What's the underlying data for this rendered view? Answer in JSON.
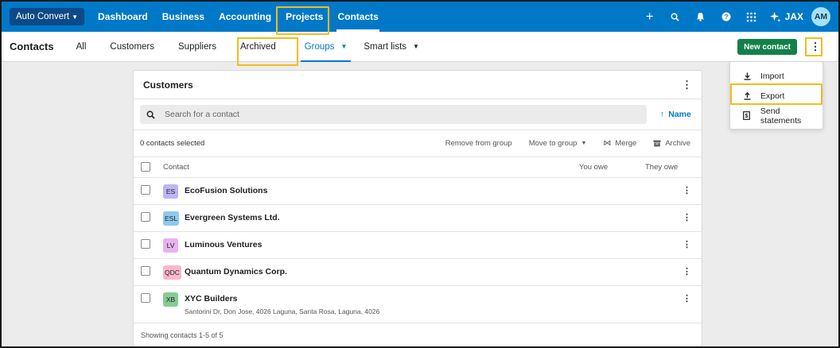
{
  "topnav": {
    "org_label": "Auto Convert",
    "links": [
      "Dashboard",
      "Business",
      "Accounting",
      "Projects",
      "Contacts"
    ],
    "jax_label": "JAX",
    "avatar_initials": "AM"
  },
  "subnav": {
    "title": "Contacts",
    "tabs": [
      "All",
      "Customers",
      "Suppliers",
      "Archived",
      "Groups",
      "Smart lists"
    ],
    "new_contact_label": "New contact"
  },
  "dropdown": {
    "items": [
      "Import",
      "Export",
      "Send statements"
    ]
  },
  "card": {
    "title": "Customers",
    "search_placeholder": "Search for a contact",
    "sort_label": "Name",
    "selected_text": "0 contacts selected",
    "actions": {
      "remove": "Remove from group",
      "move": "Move to group",
      "merge": "Merge",
      "archive": "Archive"
    },
    "columns": {
      "contact": "Contact",
      "you_owe": "You owe",
      "they_owe": "They owe"
    },
    "rows": [
      {
        "initials": "ES",
        "name": "EcoFusion Solutions",
        "color": "#b9b6f3"
      },
      {
        "initials": "ESL",
        "name": "Evergreen Systems Ltd.",
        "color": "#8fc9ee"
      },
      {
        "initials": "LV",
        "name": "Luminous Ventures",
        "color": "#e7b3ef"
      },
      {
        "initials": "QDC",
        "name": "Quantum Dynamics Corp.",
        "color": "#f9b7cf"
      },
      {
        "initials": "XB",
        "name": "XYC Builders",
        "address": "Santorini Dr, Don Jose, 4026 Laguna, Santa Rosa, Laguna, 4026",
        "color": "#86cb95"
      }
    ],
    "footer": "Showing contacts 1-5 of 5"
  },
  "colors": {
    "brand_blue": "#0078c8",
    "new_contact_green": "#13804a",
    "highlight": "#f0bd1b"
  }
}
